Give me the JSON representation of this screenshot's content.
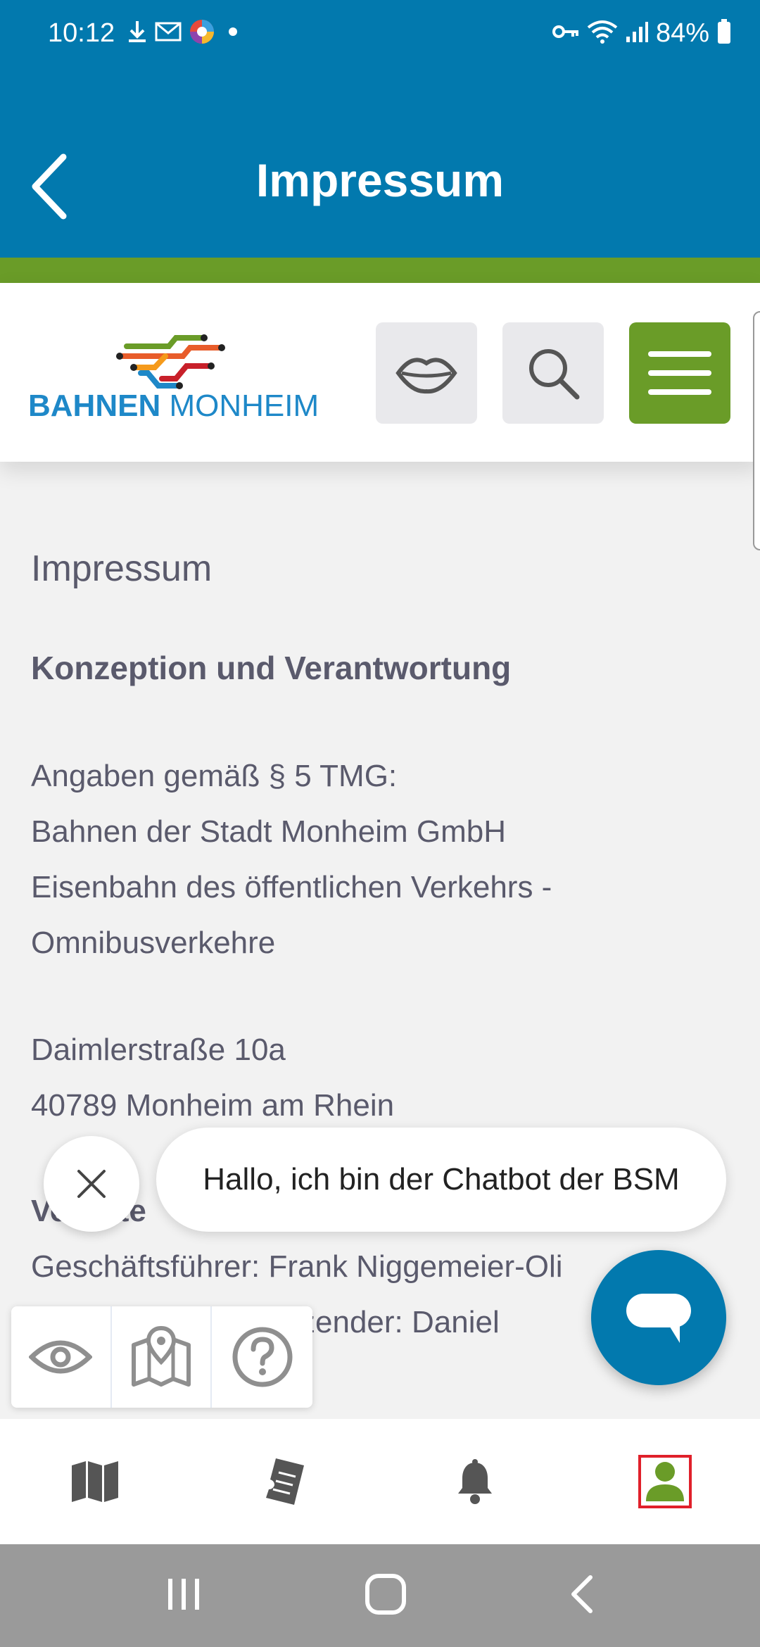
{
  "status_bar": {
    "time": "10:12",
    "battery": "84%",
    "icons_left": [
      "download-icon",
      "mail-icon",
      "color-app-icon",
      "dot-icon"
    ],
    "icons_right": [
      "vpn-key-icon",
      "wifi-icon",
      "signal-icon",
      "battery-icon"
    ]
  },
  "header": {
    "title": "Impressum",
    "back_icon": "chevron-left-icon"
  },
  "site_header": {
    "logo_word1": "BAHNEN",
    "logo_word2": "MONHEIM",
    "buttons": [
      "lips-icon",
      "search-icon",
      "hamburger-menu-icon"
    ]
  },
  "content": {
    "page_heading": "Impressum",
    "section_heading": "Konzeption und Verantwortung",
    "lines": [
      "Angaben gemäß § 5 TMG:",
      "Bahnen der Stadt Monheim GmbH",
      "Eisenbahn des öffentlichen Verkehrs -",
      "Omnibusverkehre",
      "Daimlerstraße 10a",
      "40789 Monheim am Rhein",
      "Vertrete",
      "Geschäftsführer: Frank Niggemeier-Oli",
      "zender: Daniel"
    ]
  },
  "chat": {
    "message": "Hallo, ich bin der Chatbot der BSM",
    "close_icon": "close-icon",
    "fab_icon": "chat-bubble-icon"
  },
  "a11y_toolbar": {
    "items": [
      "eye-icon",
      "map-pin-icon",
      "help-circle-icon"
    ]
  },
  "bottom_nav": {
    "items": [
      "map-icon",
      "tickets-icon",
      "bell-icon",
      "profile-icon"
    ],
    "active": "profile-icon"
  },
  "colors": {
    "primary_blue": "#0279ae",
    "accent_green": "#6a9c28",
    "text_gray": "#5a5a6c",
    "active_outline": "#e0202a"
  }
}
